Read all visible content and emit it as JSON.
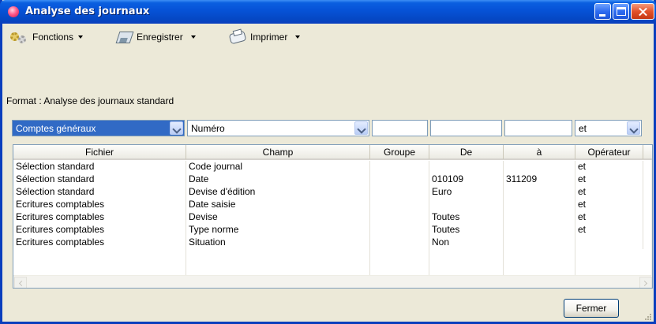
{
  "window": {
    "title": "Analyse des journaux",
    "title_icon": "app-flower-icon"
  },
  "toolbar": {
    "items": [
      {
        "label": "Fonctions",
        "icon": "gears-icon"
      },
      {
        "label": "Enregistrer",
        "icon": "save-disk-icon"
      },
      {
        "label": "Imprimer",
        "icon": "printer-icon"
      }
    ]
  },
  "format": {
    "label": "Format : Analyse des journaux standard"
  },
  "filters": {
    "fichier": "Comptes généraux",
    "champ": "Numéro",
    "groupe": "",
    "de": "",
    "a": "",
    "operateur": "et"
  },
  "grid": {
    "columns": [
      "Fichier",
      "Champ",
      "Groupe",
      "De",
      "à",
      "Opérateur"
    ],
    "rows": [
      {
        "fichier": "Sélection standard",
        "champ": "Code journal",
        "groupe": "",
        "de": "",
        "a": "",
        "operateur": "et"
      },
      {
        "fichier": "Sélection standard",
        "champ": "Date",
        "groupe": "",
        "de": "010109",
        "a": "311209",
        "operateur": "et"
      },
      {
        "fichier": "Sélection standard",
        "champ": "Devise d'édition",
        "groupe": "",
        "de": "Euro",
        "a": "",
        "operateur": "et"
      },
      {
        "fichier": "Ecritures comptables",
        "champ": "Date saisie",
        "groupe": "",
        "de": "",
        "a": "",
        "operateur": "et"
      },
      {
        "fichier": "Ecritures comptables",
        "champ": "Devise",
        "groupe": "",
        "de": "Toutes",
        "a": "",
        "operateur": "et"
      },
      {
        "fichier": "Ecritures comptables",
        "champ": "Type norme",
        "groupe": "",
        "de": "Toutes",
        "a": "",
        "operateur": "et"
      },
      {
        "fichier": "Ecritures comptables",
        "champ": "Situation",
        "groupe": "",
        "de": "Non",
        "a": "",
        "operateur": ""
      }
    ]
  },
  "footer": {
    "close_label": "Fermer"
  },
  "colors": {
    "titlebar": "#0a5fe0",
    "selection": "#316ac5",
    "face": "#ece9d8"
  }
}
